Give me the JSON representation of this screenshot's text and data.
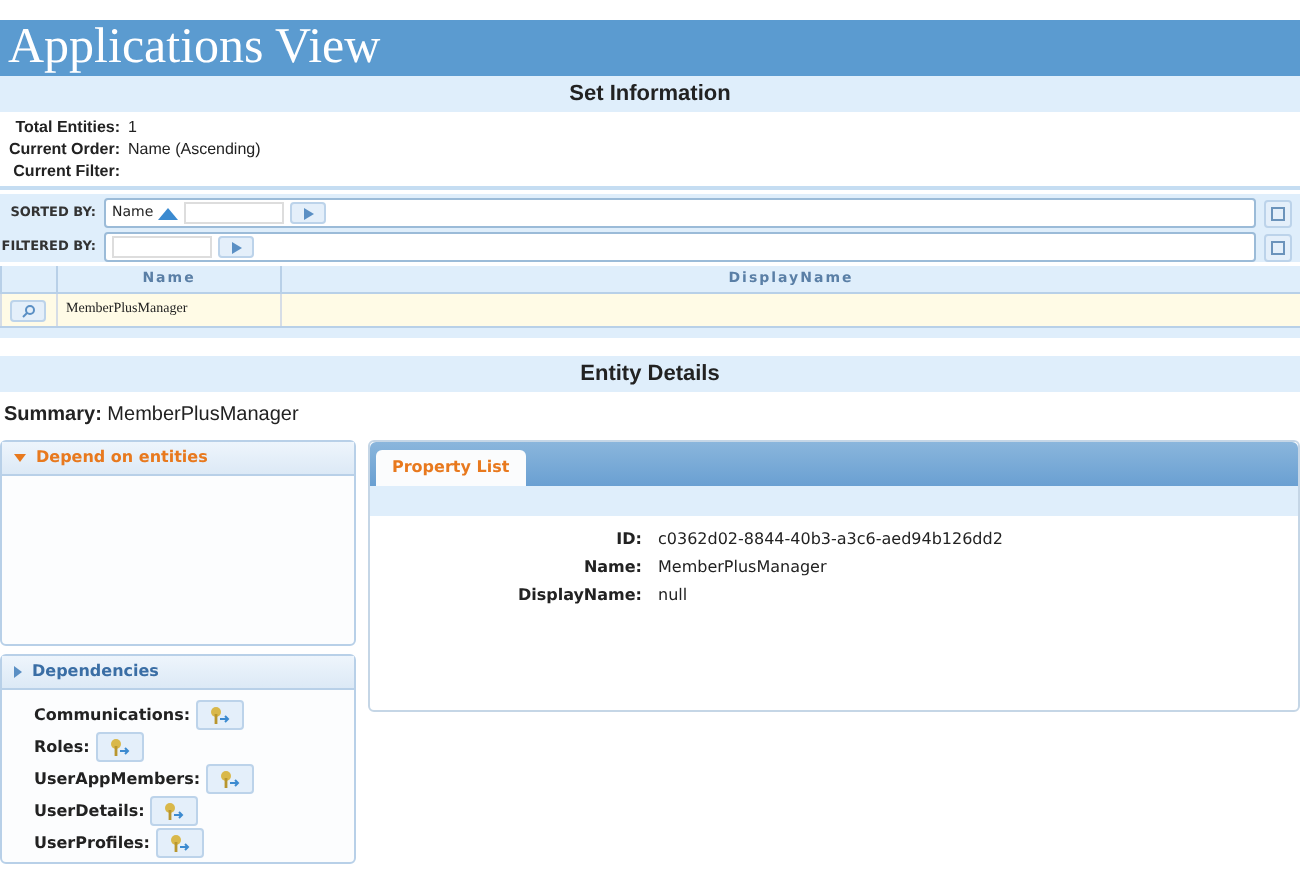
{
  "header": {
    "title": "Applications View"
  },
  "set_information": {
    "title": "Set Information",
    "fields": [
      {
        "label": "Total Entities:",
        "value": "1"
      },
      {
        "label": "Current Order:",
        "value": "Name (Ascending)"
      },
      {
        "label": "Current Filter:"
      }
    ]
  },
  "sort_bar": {
    "label": "SORTED BY:",
    "sort_field": "Name",
    "ascending": true
  },
  "filter_bar": {
    "label": "FILTERED BY:"
  },
  "table": {
    "columns": [
      "Name",
      "DisplayName"
    ],
    "rows": [
      {
        "cells": [
          "MemberPlusManager",
          ""
        ]
      }
    ]
  },
  "entity_details": {
    "title": "Entity Details",
    "summary_label": "Summary:",
    "summary_value": "MemberPlusManager"
  },
  "panels": [
    {
      "title": "Depend on entities",
      "expanded": true
    },
    {
      "title": "Dependencies",
      "expanded": false,
      "items": [
        "Communications:",
        "Roles:",
        "UserAppMembers:",
        "UserDetails:",
        "UserProfiles:"
      ]
    }
  ],
  "tabs": [
    {
      "label": "Property List",
      "selected": true
    }
  ],
  "properties": [
    {
      "label": "ID:",
      "value": "c0362d02-8844-40b3-a3c6-aed94b126dd2"
    },
    {
      "label": "Name:",
      "value": "MemberPlusManager"
    },
    {
      "label": "DisplayName:",
      "value": "null"
    }
  ]
}
